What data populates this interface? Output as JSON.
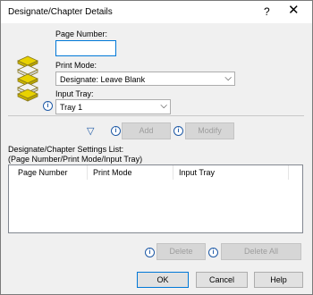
{
  "window": {
    "title": "Designate/Chapter Details",
    "help_symbol": "?",
    "close_symbol": "✕"
  },
  "page_number": {
    "label": "Page Number:",
    "value": ""
  },
  "print_mode": {
    "label": "Print Mode:",
    "value": "Designate: Leave Blank"
  },
  "input_tray": {
    "label": "Input Tray:",
    "value": "Tray 1"
  },
  "buttons": {
    "add": "Add",
    "modify": "Modify",
    "delete": "Delete",
    "delete_all": "Delete All",
    "ok": "OK",
    "cancel": "Cancel",
    "help": "Help"
  },
  "settings_list": {
    "label_line1": "Designate/Chapter Settings List:",
    "label_line2": "(Page Number/Print Mode/Input Tray)",
    "columns": [
      "Page Number",
      "Print Mode",
      "Input Tray"
    ]
  },
  "icons": {
    "info": "i",
    "arrow": "▽",
    "dropdown": "⌵",
    "colors": {
      "info": "#1f5aa6",
      "arrow": "#1f5aa6",
      "paper_yellow": "#e8d200"
    }
  }
}
